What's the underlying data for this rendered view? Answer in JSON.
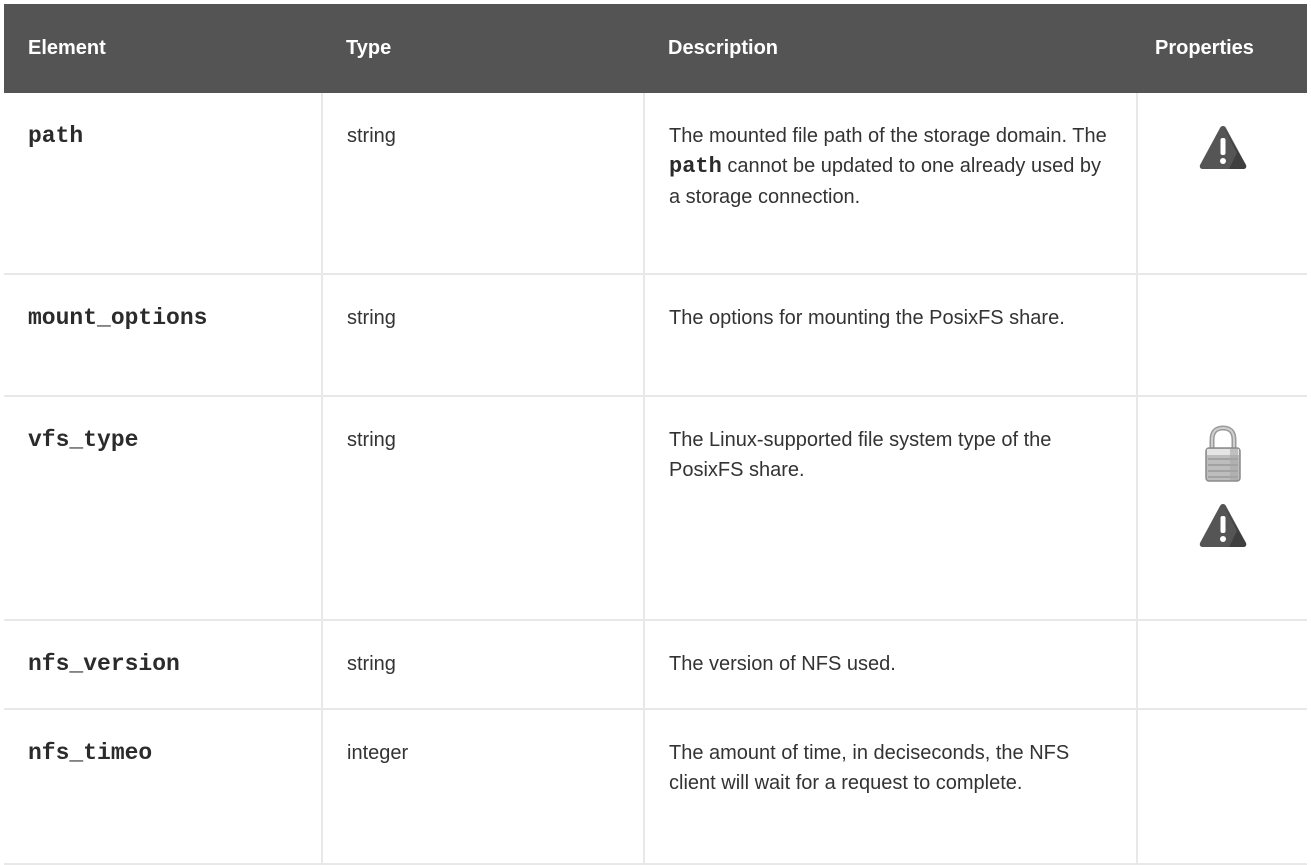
{
  "headers": {
    "element": "Element",
    "type": "Type",
    "description": "Description",
    "properties": "Properties"
  },
  "rows": [
    {
      "element": "path",
      "type": "string",
      "description_pre": "The mounted file path of the storage domain. The ",
      "description_code": "path",
      "description_post": " cannot be updated to one already used by a storage connection.",
      "properties": [
        "warning-icon"
      ]
    },
    {
      "element": "mount_options",
      "type": "string",
      "description": "The options for mounting the PosixFS share.",
      "properties": []
    },
    {
      "element": "vfs_type",
      "type": "string",
      "description": "The Linux-supported file system type of the PosixFS share.",
      "properties": [
        "lock-icon",
        "warning-icon"
      ]
    },
    {
      "element": "nfs_version",
      "type": "string",
      "description": "The version of NFS used.",
      "properties": []
    },
    {
      "element": "nfs_timeo",
      "type": "integer",
      "description": "The amount of time, in deciseconds, the NFS client will wait for a request to complete.",
      "properties": []
    }
  ],
  "colors": {
    "header_bg": "#545454",
    "header_text": "#ffffff",
    "grid": "#e8e8e8",
    "icon": "#555555"
  }
}
